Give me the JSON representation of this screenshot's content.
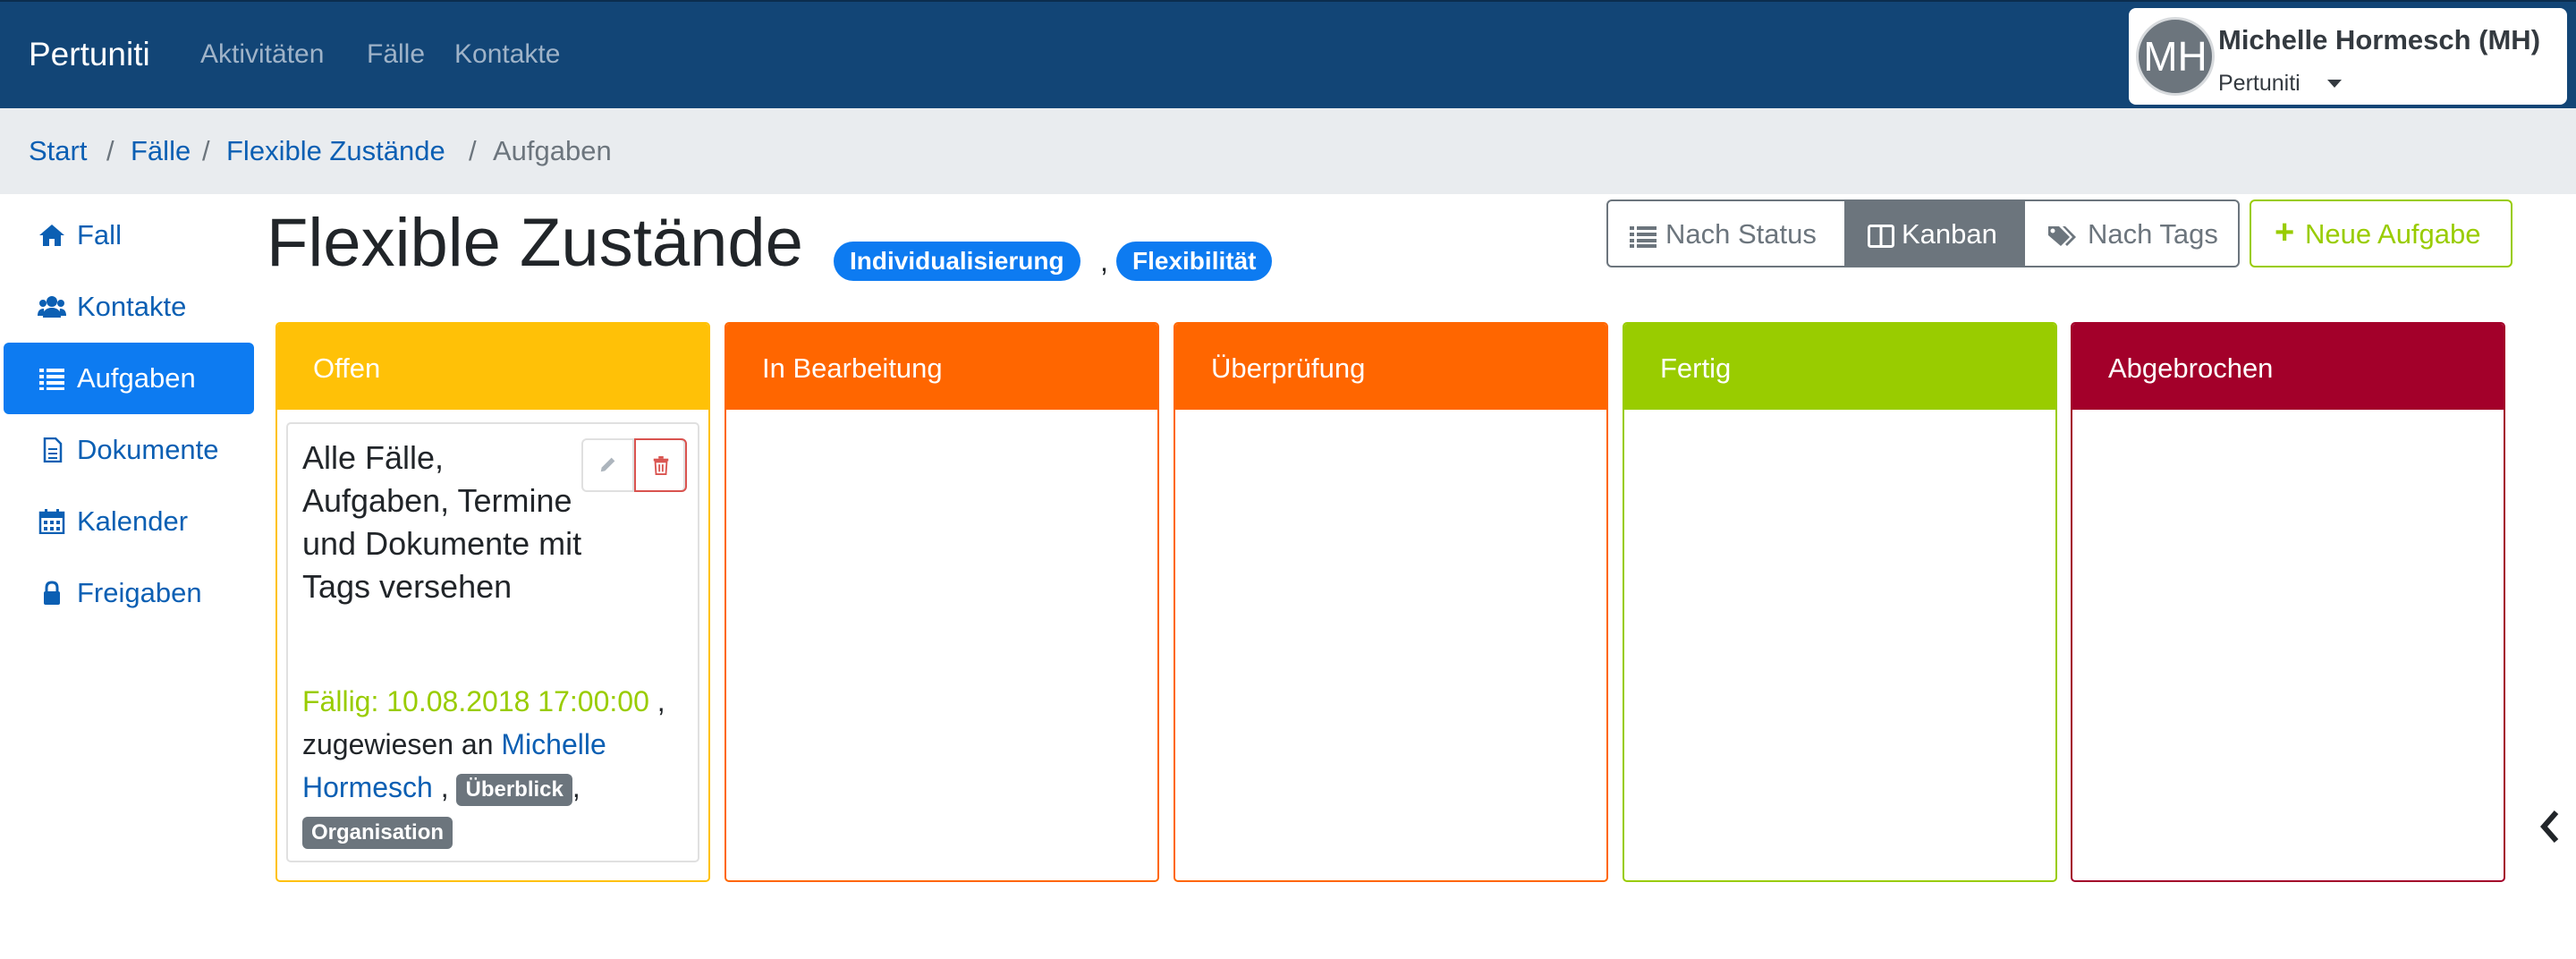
{
  "navbar": {
    "brand": "Pertuniti",
    "links": [
      "Aktivitäten",
      "Fälle",
      "Kontakte"
    ],
    "user": {
      "initials": "MH",
      "name": "Michelle Hormesch (MH)",
      "org": "Pertuniti"
    }
  },
  "breadcrumb": {
    "items": [
      "Start",
      "Fälle",
      "Flexible Zustände"
    ],
    "separator": "/",
    "current": "Aufgaben"
  },
  "sidebar": {
    "items": [
      {
        "label": "Fall",
        "icon": "home-icon"
      },
      {
        "label": "Kontakte",
        "icon": "users-icon"
      },
      {
        "label": "Aufgaben",
        "icon": "list-icon",
        "active": true
      },
      {
        "label": "Dokumente",
        "icon": "file-icon"
      },
      {
        "label": "Kalender",
        "icon": "calendar-icon"
      },
      {
        "label": "Freigaben",
        "icon": "lock-icon"
      }
    ]
  },
  "header": {
    "title": "Flexible Zustände",
    "tags": [
      "Individualisierung",
      "Flexibilität"
    ],
    "tag_separator": ","
  },
  "view_buttons": {
    "by_status": "Nach Status",
    "kanban": "Kanban",
    "by_tags": "Nach Tags",
    "active": "kanban"
  },
  "new_task_label": "Neue Aufgabe",
  "kanban": {
    "columns": [
      {
        "title": "Offen",
        "color": "#ffc107"
      },
      {
        "title": "In Bearbeitung",
        "color": "#ff6600"
      },
      {
        "title": "Überprüfung",
        "color": "#ff6600"
      },
      {
        "title": "Fertig",
        "color": "#99cc00"
      },
      {
        "title": "Abgebrochen",
        "color": "#a3002a"
      }
    ],
    "card": {
      "title": "Alle Fälle, Aufgaben, Termine und Dokumente mit Tags versehen",
      "due": "Fällig: 10.08.2018 17:00:00",
      "comma": ",",
      "assigned_prefix": "zugewiesen an",
      "assignee": "Michelle Hormesch",
      "tags": [
        "Überblick",
        "Organisation"
      ]
    }
  },
  "colors": {
    "navbar": "#124576",
    "primary": "#0d7bf1",
    "link": "#0b5fb3",
    "success": "#99cc00",
    "secondary": "#6c757d"
  }
}
